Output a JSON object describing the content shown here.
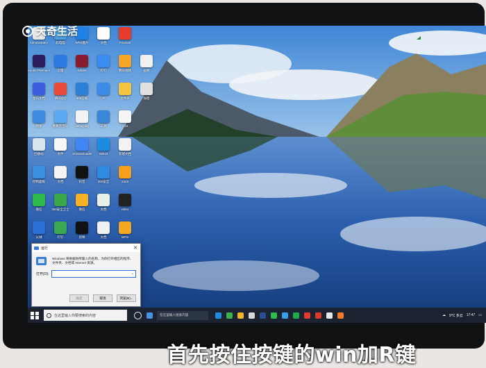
{
  "watermark": {
    "text": "天奇生活"
  },
  "desktop_icons": [
    {
      "label": "Administrator",
      "color": "#e8e8e8"
    },
    {
      "label": "此电脑",
      "color": "#4aa3df"
    },
    {
      "label": "WPS图片",
      "color": "#1f80e6"
    },
    {
      "label": "文档",
      "color": "#ffffff"
    },
    {
      "label": "Foxmail",
      "color": "#e63c2e"
    },
    {
      "label": "Adobe Premiere",
      "color": "#2b1d5e"
    },
    {
      "label": "迅雷",
      "color": "#2c7be5"
    },
    {
      "label": "Adobe",
      "color": "#8b1c2f"
    },
    {
      "label": "钉钉",
      "color": "#3b8cf0"
    },
    {
      "label": "腾讯视频",
      "color": "#f7a528"
    },
    {
      "label": "画图",
      "color": "#f0f0f0"
    },
    {
      "label": "金山文档",
      "color": "#3b5fe0"
    },
    {
      "label": "腾讯QQ",
      "color": "#e94a3a"
    },
    {
      "label": "360压缩",
      "color": "#2e7fd8"
    },
    {
      "label": "JX",
      "color": "#3c8be6"
    },
    {
      "label": "文件夹",
      "color": "#f5c542"
    },
    {
      "label": "加密",
      "color": "#e0e0e0"
    },
    {
      "label": "网易",
      "color": "#3d8be0"
    },
    {
      "label": "网易云音乐",
      "color": "#5ba9f0"
    },
    {
      "label": "debug.log",
      "color": "#f2f2f2"
    },
    {
      "label": "工具",
      "color": "#3a87d8"
    },
    {
      "label": "1.txt",
      "color": "#f5f5f5"
    },
    {
      "label": "回收站",
      "color": "#d8e4ee"
    },
    {
      "label": "文件",
      "color": "#f6f6f6"
    },
    {
      "label": "JXDownloader",
      "color": "#4285f4"
    },
    {
      "label": "Win10",
      "color": "#1d8ce0"
    },
    {
      "label": "新建文档",
      "color": "#f2f2f2"
    },
    {
      "label": "控制面板",
      "color": "#3b8fe0"
    },
    {
      "label": "文档",
      "color": "#f4f4f4"
    },
    {
      "label": "抖音",
      "color": "#111111"
    },
    {
      "label": "360安全",
      "color": "#2f8ae2"
    },
    {
      "label": "2345",
      "color": "#f5a01c"
    },
    {
      "label": "微信",
      "color": "#2dbb4b"
    },
    {
      "label": "360安全卫士",
      "color": "#38a84a"
    },
    {
      "label": "微信",
      "color": "#f5b226"
    },
    {
      "label": "文档",
      "color": "#e8f0e8"
    },
    {
      "label": "video",
      "color": "#222222"
    },
    {
      "label": "火绒",
      "color": "#2c6fd8"
    },
    {
      "label": "钉钉",
      "color": "#3aa850"
    },
    {
      "label": "剪映",
      "color": "#111111"
    },
    {
      "label": "文档",
      "color": "#f0f0f0"
    },
    {
      "label": "WPS",
      "color": "#f5a623"
    }
  ],
  "run_dialog": {
    "title": "运行",
    "description": "Windows 将根据你所输入的名称，为你打开相应的程序、文件夹、文档或 Internet 资源。",
    "open_label": "打开(O):",
    "open_value": "",
    "ok_label": "确定",
    "cancel_label": "取消",
    "browse_label": "浏览(B)..."
  },
  "taskbar": {
    "search_placeholder": "在这里输入你要搜索的内容",
    "search2_text": "在这里输入搜索内容",
    "weather": "9°C 多云",
    "time": "17:47"
  },
  "caption": {
    "text": "首先按住按键的win加R键"
  }
}
